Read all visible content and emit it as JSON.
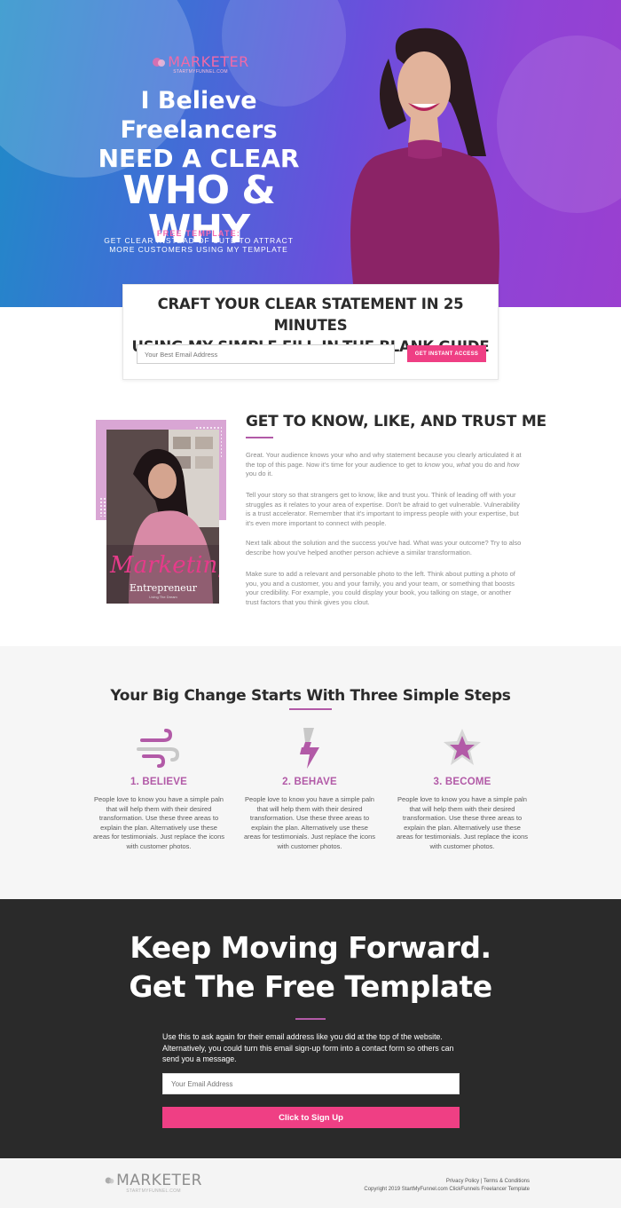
{
  "brand": {
    "logo": "MARKETER",
    "logo_sub": "STARTMYFUNNEL.COM"
  },
  "hero": {
    "line1": "I Believe",
    "line2": "Freelancers",
    "line3": "NEED A CLEAR",
    "line4": "WHO & WHY",
    "free_label": "FREE TEMPLATE:",
    "subline1": "GET CLEAR INSTEAD OF CUTE TO ATTRACT",
    "subline2": "MORE CUSTOMERS USING MY TEMPLATE"
  },
  "optin": {
    "title_line1": "CRAFT YOUR CLEAR STATEMENT IN 25 MINUTES",
    "title_line2": "USING MY SIMPLE FILL-IN-THE BLANK GUIDE",
    "email_placeholder": "Your Best Email Address",
    "button_label": "GET INSTANT ACCESS"
  },
  "about": {
    "title": "GET TO KNOW, LIKE, AND TRUST ME",
    "p1_a": "Great. Your audience knows your who and why statement because you clearly articulated it at the top of this page. Now it's time for your audience to get to ",
    "p1_know": "know",
    "p1_b": " you, ",
    "p1_what": "what",
    "p1_c": " you do and ",
    "p1_how": "how",
    "p1_d": " you do it.",
    "p2": "Tell your story so that strangers get to know, like and trust you. Think of leading off with your struggles as it relates to your area of expertise. Don't be afraid to get vulnerable. Vulnerability is a trust accelerator.  Remember that it's important to impress people with your expertise, but it's even more important to connect with people.",
    "p3": "Next talk about the solution and the success you've had. What was your outcome? Try to also describe how you've helped another person achieve a similar transformation.",
    "p4": "Make sure to add a relevant and personable photo to the left. Think about putting a photo of you, you and a customer,  you and your family, you and your team, or something that boosts your credibility. For example, you could display your book, you talking on stage, or another trust factors that you think gives you clout.",
    "photo_script": "Marketing",
    "photo_word": "Entrepreneur",
    "photo_small": "Living The Dream"
  },
  "steps": {
    "title": "Your Big Change Starts With Three Simple Steps",
    "items": [
      {
        "icon": "wind-icon",
        "title": "1. BELIEVE",
        "text": "People love to know you have a simple paln that will help them with their desired transformation. Use these three areas to explain the plan. Alternatively use these areas for testimonials. Just replace the icons with customer photos."
      },
      {
        "icon": "bolt-icon",
        "title": "2. BEHAVE",
        "text": "People love to know you have a simple paln that will help them with their desired transformation. Use these three areas to explain the plan. Alternatively use these areas for testimonials. Just replace the icons with customer photos."
      },
      {
        "icon": "star-icon",
        "title": "3. BECOME",
        "text": "People love to know you have a simple paln that will help them with their desired transformation. Use these three areas to explain the plan. Alternatively use these areas for testimonials. Just replace the icons with customer photos."
      }
    ]
  },
  "cta": {
    "line1": "Keep Moving Forward.",
    "line2": "Get The Free Template",
    "text": "Use this to ask again for their email address like you did at the top of the website. Alternatively, you could turn this email sign-up form into a contact form so others can send you a message.",
    "email_placeholder": "Your Email Address",
    "button_label": "Click to Sign Up"
  },
  "footer": {
    "privacy": "Privacy Policy",
    "separator": " | ",
    "terms": "Terms & Conditions",
    "copyright": "Copyright 2019 StartMyFunnel.com ClickFunnels Freelancer Template"
  },
  "colors": {
    "accent_pink": "#ef3f84",
    "accent_purple": "#b25aa7",
    "dark": "#2a2a2a"
  }
}
